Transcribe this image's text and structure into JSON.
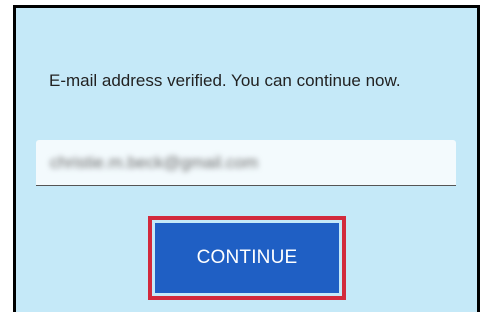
{
  "message": "E-mail address verified. You can continue now.",
  "email": {
    "value": "christie.m.beck@gmail.com"
  },
  "continue_button": {
    "label": "CONTINUE"
  },
  "colors": {
    "panel_background": "#c5e9f8",
    "button_background": "#1f5fc4",
    "highlight_border": "#d22a3c"
  }
}
